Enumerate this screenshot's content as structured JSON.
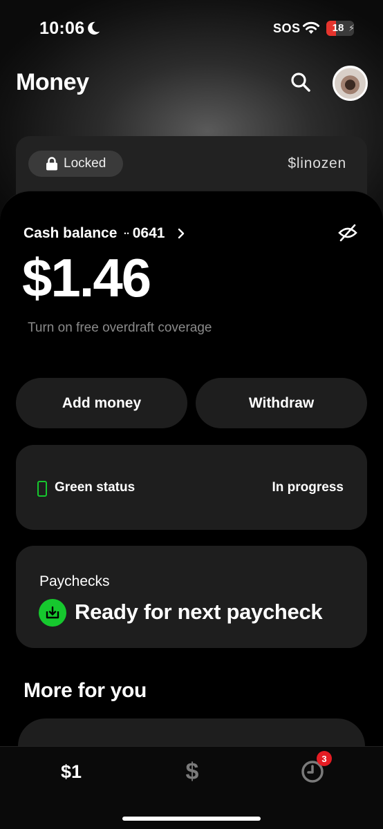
{
  "status_bar": {
    "time": "10:06",
    "sos": "SOS",
    "battery": "18",
    "battery_level": 0.18,
    "icons": [
      "moon-icon",
      "wifi-icon",
      "battery-icon"
    ]
  },
  "header": {
    "title": "Money",
    "icons": [
      "search-icon",
      "avatar"
    ]
  },
  "account_card": {
    "locked_label": "Locked",
    "cashtag": "$linozen"
  },
  "balance": {
    "label": "Cash balance",
    "masked_dots": "••",
    "last4": "0641",
    "amount": "$1.46",
    "overdraft_link": "Turn on free overdraft coverage"
  },
  "actions": {
    "add_money": "Add money",
    "withdraw": "Withdraw"
  },
  "status_card": {
    "label": "Green status",
    "state": "In progress"
  },
  "paychecks": {
    "title": "Paychecks",
    "status": "Ready for next paycheck"
  },
  "more": {
    "title": "More for you"
  },
  "tab_bar": {
    "money_tab": "$1",
    "cash_tab": "$",
    "activity_badge": "3"
  },
  "colors": {
    "accent_green": "#16c82e",
    "badge_red": "#e51c23",
    "card_bg": "#1e1e1e"
  }
}
